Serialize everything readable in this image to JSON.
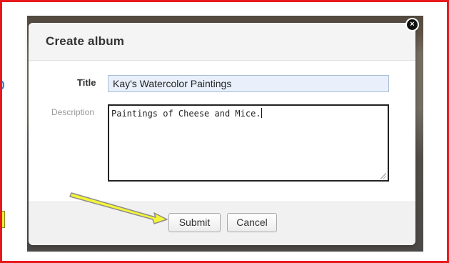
{
  "dialog": {
    "title": "Create album",
    "close_glyph": "×",
    "close_icon": "close-icon"
  },
  "form": {
    "title_label": "Title",
    "title_value": "Kay's Watercolor Paintings",
    "description_label": "Description",
    "description_value": "Paintings of Cheese and Mice."
  },
  "buttons": {
    "submit_label": "Submit",
    "cancel_label": "Cancel"
  },
  "annotation": {
    "arrow_icon": "arrow-icon",
    "arrow_color": "#f5f53a",
    "arrow_outline": "#8c8c8c",
    "border_color": "#e8191c"
  }
}
